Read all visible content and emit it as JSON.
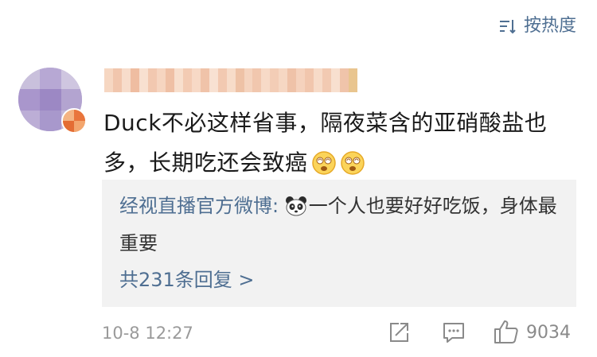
{
  "toolbar": {
    "sort_label": "按热度",
    "sort_icon": "sort-icon"
  },
  "comment": {
    "text": "Duck不必这样省事，隔夜菜含的亚硝酸盐也多，长期吃还会致癌",
    "emojis": [
      "dizzy-face-emoji",
      "dizzy-face-emoji"
    ],
    "reply": {
      "author": "经视直播官方微博",
      "separator": ": ",
      "text": "一个人也要好好吃饭，身体最重要",
      "emoji": "panda-emoji",
      "count_label": "共231条回复 >"
    },
    "timestamp": "10-8 12:27",
    "like_count": "9034"
  },
  "colors": {
    "link": "#4f6f92",
    "reply_bg": "#f2f2f2",
    "meta": "#9a9a9a"
  }
}
